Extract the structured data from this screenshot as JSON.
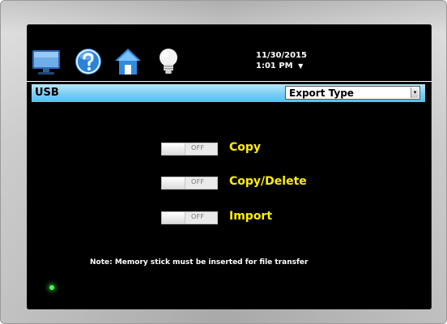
{
  "status_bar": {
    "date": "11/30/2015",
    "time": "1:01 PM",
    "dropdown_arrow": "▼"
  },
  "nav_icons": [
    "monitor-icon",
    "help-icon",
    "home-icon",
    "lightbulb-icon"
  ],
  "header": {
    "title": "USB",
    "export_type_label": "Export Type",
    "select_arrow": "▾"
  },
  "options": [
    {
      "label": "Copy",
      "state": "OFF"
    },
    {
      "label": "Copy/Delete",
      "state": "OFF"
    },
    {
      "label": "Import",
      "state": "OFF"
    }
  ],
  "note": "Note:  Memory stick must be inserted for file transfer",
  "colors": {
    "screen_background": "#000000",
    "header_bar": "#79cef3",
    "option_label": "#ffef00",
    "status_led": "#45ff4f"
  }
}
